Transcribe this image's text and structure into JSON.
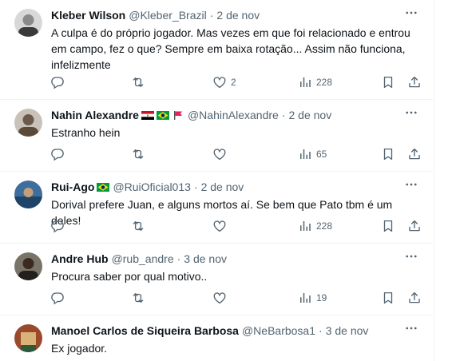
{
  "ui": {
    "more_label": "···",
    "icons": {
      "more": "more-horizontal-icon",
      "reply": "reply-icon",
      "retweet": "retweet-icon",
      "like": "heart-icon",
      "views": "analytics-icon",
      "bookmark": "bookmark-icon",
      "share": "share-icon"
    },
    "colors": {
      "text": "#0f1419",
      "secondary": "#536471",
      "divider": "#eff3f4"
    }
  },
  "replies": [
    {
      "name": "Kleber Wilson",
      "handle": "@Kleber_Brazil",
      "separator": "·",
      "date": "2 de nov",
      "text_lines": [
        "A culpa é do próprio jogador. Mas vezes em que foi relacionado e entrou",
        "em campo, fez o que? Sempre em baixa rotação... Assim não funciona,",
        "infelizmente"
      ],
      "likes": "2",
      "views": "228",
      "flags": []
    },
    {
      "name": "Nahin Alexandre",
      "handle": "@NahinAlexandre",
      "separator": "·",
      "date": "2 de nov",
      "text_lines": [
        "Estranho hein"
      ],
      "likes": "",
      "views": "65",
      "flags": [
        "egypt-flag",
        "brazil-flag",
        "red-flag"
      ]
    },
    {
      "name": "Rui-Ago",
      "handle": "@RuiOficial013",
      "separator": "·",
      "date": "2 de nov",
      "text_lines": [
        "Dorival prefere Juan, e alguns mortos aí. Se bem que Pato tbm é um deles!"
      ],
      "likes": "",
      "views": "228",
      "flags": [
        "brazil-flag"
      ]
    },
    {
      "name": "Andre Hub",
      "handle": "@rub_andre",
      "separator": "·",
      "date": "3 de nov",
      "text_lines": [
        "Procura saber por qual motivo.."
      ],
      "likes": "",
      "views": "19",
      "flags": []
    },
    {
      "name": "Manoel Carlos de Siqueira Barbosa",
      "handle": "@NeBarbosa1",
      "separator": "·",
      "date": "3 de nov",
      "text_lines": [
        "Ex jogador."
      ],
      "flags": []
    }
  ]
}
